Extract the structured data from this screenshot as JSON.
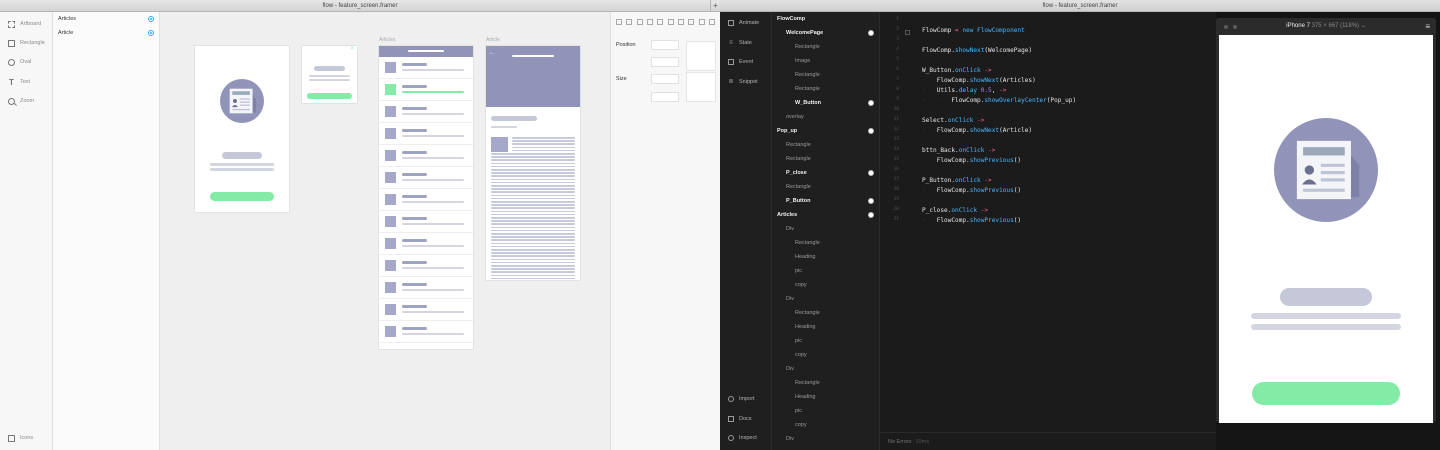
{
  "left_window": {
    "title": "flow - feature_screen.framer",
    "plus": "+",
    "tools": [
      {
        "label": "Artboard",
        "icon": "artboard-icon"
      },
      {
        "label": "Rectangle",
        "icon": "rectangle-icon"
      },
      {
        "label": "Oval",
        "icon": "oval-icon"
      },
      {
        "label": "Text",
        "icon": "text-icon"
      },
      {
        "label": "Zoom",
        "icon": "zoom-icon"
      }
    ],
    "bottom_tool": {
      "label": "Icons",
      "icon": "icons-icon"
    },
    "layers": [
      {
        "label": "Articles"
      },
      {
        "label": "Article"
      }
    ],
    "artboard_labels": {
      "articles": "Articles",
      "article": "Article"
    },
    "popup_close": "×",
    "inspector": {
      "position_label": "Position",
      "size_label": "Size"
    }
  },
  "right_window": {
    "title": "flow - feature_screen.framer",
    "nav": {
      "top": [
        "Animate",
        "State",
        "Event",
        "Snippet"
      ],
      "bottom": [
        "Import",
        "Docs",
        "Inspect"
      ]
    },
    "tree": [
      {
        "label": "FlowComp",
        "level": 0,
        "bold": true,
        "target": false
      },
      {
        "label": "WelcomePage",
        "level": 1,
        "bold": true,
        "target": true
      },
      {
        "label": "Rectangle",
        "level": 2,
        "bold": false,
        "target": false
      },
      {
        "label": "Image",
        "level": 2,
        "bold": false,
        "target": false
      },
      {
        "label": "Rectangle",
        "level": 2,
        "bold": false,
        "target": false
      },
      {
        "label": "Rectangle",
        "level": 2,
        "bold": false,
        "target": false
      },
      {
        "label": "W_Button",
        "level": 2,
        "bold": true,
        "target": true
      },
      {
        "label": "overlay",
        "level": 1,
        "bold": false,
        "target": false
      },
      {
        "label": "Pop_up",
        "level": 0,
        "bold": true,
        "target": true
      },
      {
        "label": "Rectangle",
        "level": 1,
        "bold": false,
        "target": false
      },
      {
        "label": "Rectangle",
        "level": 1,
        "bold": false,
        "target": false
      },
      {
        "label": "P_close",
        "level": 1,
        "bold": true,
        "target": true
      },
      {
        "label": "Rectangle",
        "level": 1,
        "bold": false,
        "target": false
      },
      {
        "label": "P_Button",
        "level": 1,
        "bold": true,
        "target": true
      },
      {
        "label": "Articles",
        "level": 0,
        "bold": true,
        "target": true
      },
      {
        "label": "Div",
        "level": 1,
        "bold": false,
        "target": false
      },
      {
        "label": "Rectangle",
        "level": 2,
        "bold": false,
        "target": false
      },
      {
        "label": "Heading",
        "level": 2,
        "bold": false,
        "target": false
      },
      {
        "label": "pic",
        "level": 2,
        "bold": false,
        "target": false
      },
      {
        "label": "copy",
        "level": 2,
        "bold": false,
        "target": false
      },
      {
        "label": "Div",
        "level": 1,
        "bold": false,
        "target": false
      },
      {
        "label": "Rectangle",
        "level": 2,
        "bold": false,
        "target": false
      },
      {
        "label": "Heading",
        "level": 2,
        "bold": false,
        "target": false
      },
      {
        "label": "pic",
        "level": 2,
        "bold": false,
        "target": false
      },
      {
        "label": "copy",
        "level": 2,
        "bold": false,
        "target": false
      },
      {
        "label": "Div",
        "level": 1,
        "bold": false,
        "target": false
      },
      {
        "label": "Rectangle",
        "level": 2,
        "bold": false,
        "target": false
      },
      {
        "label": "Heading",
        "level": 2,
        "bold": false,
        "target": false
      },
      {
        "label": "pic",
        "level": 2,
        "bold": false,
        "target": false
      },
      {
        "label": "copy",
        "level": 2,
        "bold": false,
        "target": false
      },
      {
        "label": "Div",
        "level": 1,
        "bold": false,
        "target": false
      }
    ],
    "line_numbers": [
      "1",
      "2",
      "3",
      "4",
      "5",
      "6",
      "7",
      "8",
      "9",
      "10",
      "11",
      "12",
      "13",
      "14",
      "15",
      "16",
      "17",
      "18",
      "19",
      "20",
      "21"
    ],
    "code": [
      {
        "line": 2,
        "tokens": [
          [
            "t",
            "FlowComp "
          ],
          [
            "op",
            "= "
          ],
          [
            "kw",
            "new FlowComponent"
          ]
        ]
      },
      {
        "line": 4,
        "tokens": [
          [
            "t",
            "FlowComp."
          ],
          [
            "kw",
            "showNext"
          ],
          [
            "t",
            "(WelcomePage)"
          ]
        ]
      },
      {
        "line": 6,
        "tokens": [
          [
            "t",
            "W_Button."
          ],
          [
            "kw",
            "onClick"
          ],
          [
            "op",
            " ->"
          ]
        ]
      },
      {
        "line": 7,
        "tokens": [
          [
            "ind",
            "·   "
          ],
          [
            "t",
            "FlowComp."
          ],
          [
            "kw",
            "showNext"
          ],
          [
            "t",
            "(Articles)"
          ]
        ]
      },
      {
        "line": 8,
        "tokens": [
          [
            "ind",
            "·   "
          ],
          [
            "t",
            "Utils."
          ],
          [
            "kw",
            "delay "
          ],
          [
            "num",
            "0.5"
          ],
          [
            "t",
            ", "
          ],
          [
            "op",
            "->"
          ]
        ]
      },
      {
        "line": 9,
        "tokens": [
          [
            "ind",
            "·   ·   "
          ],
          [
            "t",
            "FlowComp."
          ],
          [
            "kw",
            "showOverlayCenter"
          ],
          [
            "t",
            "(Pop_up)"
          ]
        ]
      },
      {
        "line": 11,
        "tokens": [
          [
            "t",
            "Select."
          ],
          [
            "kw",
            "onClick"
          ],
          [
            "op",
            " ->"
          ]
        ]
      },
      {
        "line": 12,
        "tokens": [
          [
            "ind",
            "·   "
          ],
          [
            "t",
            "FlowComp."
          ],
          [
            "kw",
            "showNext"
          ],
          [
            "t",
            "(Article)"
          ]
        ]
      },
      {
        "line": 14,
        "tokens": [
          [
            "t",
            "bttn_Back."
          ],
          [
            "kw",
            "onClick"
          ],
          [
            "op",
            " ->"
          ]
        ]
      },
      {
        "line": 15,
        "tokens": [
          [
            "ind",
            "·   "
          ],
          [
            "t",
            "FlowComp."
          ],
          [
            "kw",
            "showPrevious"
          ],
          [
            "t",
            "()"
          ]
        ]
      },
      {
        "line": 17,
        "tokens": [
          [
            "t",
            "P_Button."
          ],
          [
            "kw",
            "onClick"
          ],
          [
            "op",
            " ->"
          ]
        ]
      },
      {
        "line": 18,
        "tokens": [
          [
            "ind",
            "·   "
          ],
          [
            "t",
            "FlowComp."
          ],
          [
            "kw",
            "showPrevious"
          ],
          [
            "t",
            "()"
          ]
        ]
      },
      {
        "line": 20,
        "tokens": [
          [
            "t",
            "P_close."
          ],
          [
            "kw",
            "onClick"
          ],
          [
            "op",
            " ->"
          ]
        ]
      },
      {
        "line": 21,
        "tokens": [
          [
            "ind",
            "·   "
          ],
          [
            "t",
            "FlowComp."
          ],
          [
            "kw",
            "showPrevious"
          ],
          [
            "t",
            "()"
          ]
        ]
      }
    ],
    "status": {
      "text": "No Errors",
      "time": "19ms"
    },
    "preview": {
      "device": "iPhone 7",
      "dims": "375 × 667 (118%)",
      "chevron": "⌄",
      "menu": "≡"
    }
  },
  "colors": {
    "accent_blue": "#31a8ff",
    "keyword": "#49b6ff",
    "number": "#b37dff",
    "operator": "#ff5ea0",
    "button_green": "#84eba7",
    "illustration_purple": "#9194b8"
  }
}
